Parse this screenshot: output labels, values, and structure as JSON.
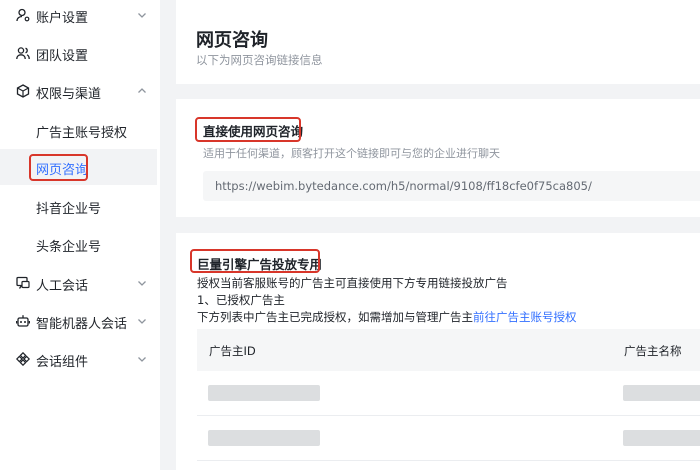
{
  "sidebar": {
    "items": [
      {
        "label": "账户设置",
        "icon": "user-gear-icon"
      },
      {
        "label": "团队设置",
        "icon": "team-icon"
      },
      {
        "label": "权限与渠道",
        "icon": "cube-icon"
      },
      {
        "label": "人工会话",
        "icon": "chat-icon"
      },
      {
        "label": "智能机器人会话",
        "icon": "robot-icon"
      },
      {
        "label": "会话组件",
        "icon": "component-icon"
      }
    ],
    "subitems": [
      "广告主账号授权",
      "网页咨询",
      "抖音企业号",
      "头条企业号"
    ],
    "active_subitem": "网页咨询"
  },
  "header": {
    "title": "网页咨询",
    "subtitle": "以下为网页咨询链接信息"
  },
  "direct": {
    "title": "直接使用网页咨询",
    "desc": "适用于任何渠道，顾客打开这个链接即可与您的企业进行聊天",
    "url": "https://webim.bytedance.com/h5/normal/9108/ff18cfe0f75ca805/"
  },
  "ads": {
    "title": "巨量引擎广告投放专用",
    "line1": "授权当前客服账号的广告主可直接使用下方专用链接投放广告",
    "line2": "1、已授权广告主",
    "line3_prefix": "下方列表中广告主已完成授权，如需增加与管理广告主",
    "line3_link": "前往广告主账号授权",
    "columns": [
      "广告主ID",
      "广告主名称"
    ]
  },
  "colors": {
    "accent": "#3370ff",
    "highlight": "#d8362a"
  }
}
